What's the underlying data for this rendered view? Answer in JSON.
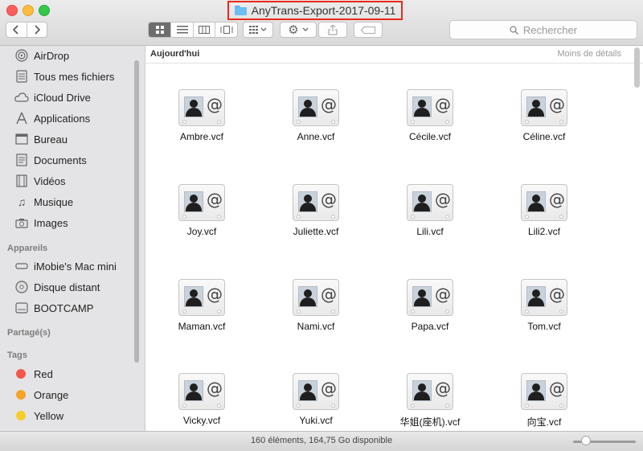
{
  "window": {
    "title": "AnyTrans-Export-2017-09-11"
  },
  "toolbar": {
    "search_placeholder": "Rechercher"
  },
  "sidebar": {
    "favorites": [
      {
        "label": "AirDrop",
        "icon": "airdrop-icon"
      },
      {
        "label": "Tous mes fichiers",
        "icon": "all-files-icon"
      },
      {
        "label": "iCloud Drive",
        "icon": "cloud-icon"
      },
      {
        "label": "Applications",
        "icon": "applications-icon"
      },
      {
        "label": "Bureau",
        "icon": "desktop-icon"
      },
      {
        "label": "Documents",
        "icon": "documents-icon"
      },
      {
        "label": "Vidéos",
        "icon": "film-icon"
      },
      {
        "label": "Musique",
        "icon": "music-icon"
      },
      {
        "label": "Images",
        "icon": "camera-icon"
      }
    ],
    "devices_header": "Appareils",
    "devices": [
      {
        "label": "iMobie's Mac mini",
        "icon": "mac-mini-icon"
      },
      {
        "label": "Disque distant",
        "icon": "disc-icon"
      },
      {
        "label": "BOOTCAMP",
        "icon": "drive-icon"
      }
    ],
    "shared_header": "Partagé(s)",
    "tags_header": "Tags",
    "tags": [
      {
        "label": "Red",
        "color": "#f5574b"
      },
      {
        "label": "Orange",
        "color": "#f7a22a"
      },
      {
        "label": "Yellow",
        "color": "#f6cd2c"
      }
    ]
  },
  "main": {
    "section_title": "Aujourd'hui",
    "section_link": "Moins de détails",
    "files": [
      "Ambre.vcf",
      "Anne.vcf",
      "Cécile.vcf",
      "Céline.vcf",
      "Joy.vcf",
      "Juliette.vcf",
      "Lili.vcf",
      "Lili2.vcf",
      "Maman.vcf",
      "Nami.vcf",
      "Papa.vcf",
      "Tom.vcf",
      "Vicky.vcf",
      "Yuki.vcf",
      "华姐(座机).vcf",
      "向宝.vcf"
    ]
  },
  "status": {
    "text": "160 éléments, 164,75 Go disponible",
    "zoom_fraction": 0.2
  }
}
